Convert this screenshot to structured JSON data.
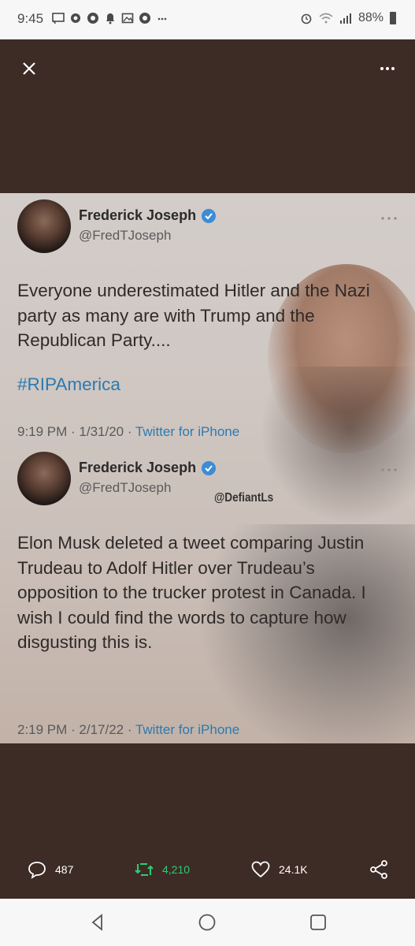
{
  "status_bar": {
    "time": "9:45",
    "battery": "88%",
    "notification_icons": [
      "cast-icon",
      "settings-icon",
      "chrome-icon",
      "bell-icon",
      "gallery-icon",
      "chrome-icon",
      "more-icon"
    ],
    "right_icons": [
      "alarm-icon",
      "wifi-icon",
      "signal-icon",
      "battery-icon"
    ]
  },
  "viewer": {
    "close_icon": "close-icon",
    "more_icon": "more-horizontal-icon"
  },
  "tweets": [
    {
      "name": "Frederick Joseph",
      "handle": "@FredTJoseph",
      "verified": true,
      "text": "Everyone underestimated Hitler and the Nazi party as many are with Trump and the Republican Party....",
      "hashtag": "#RIPAmerica",
      "time": "9:19 PM · 1/31/20 · ",
      "source": "Twitter for iPhone"
    },
    {
      "name": "Frederick Joseph",
      "handle": "@FredTJoseph",
      "verified": true,
      "text": "Elon Musk deleted a tweet comparing Justin Trudeau to Adolf Hitler over Trudeau’s opposition to the trucker protest in Canada. I wish I could find the words to capture how disgusting this is.",
      "time": "2:19 PM · 2/17/22 · ",
      "source": "Twitter for iPhone"
    }
  ],
  "watermark": "@DefiantLs",
  "actions": {
    "replies": "487",
    "retweets": "4,210",
    "likes": "24.1K",
    "retweet_color": "#2ecc71"
  },
  "navbar": [
    "back-icon",
    "home-icon",
    "recents-icon"
  ]
}
